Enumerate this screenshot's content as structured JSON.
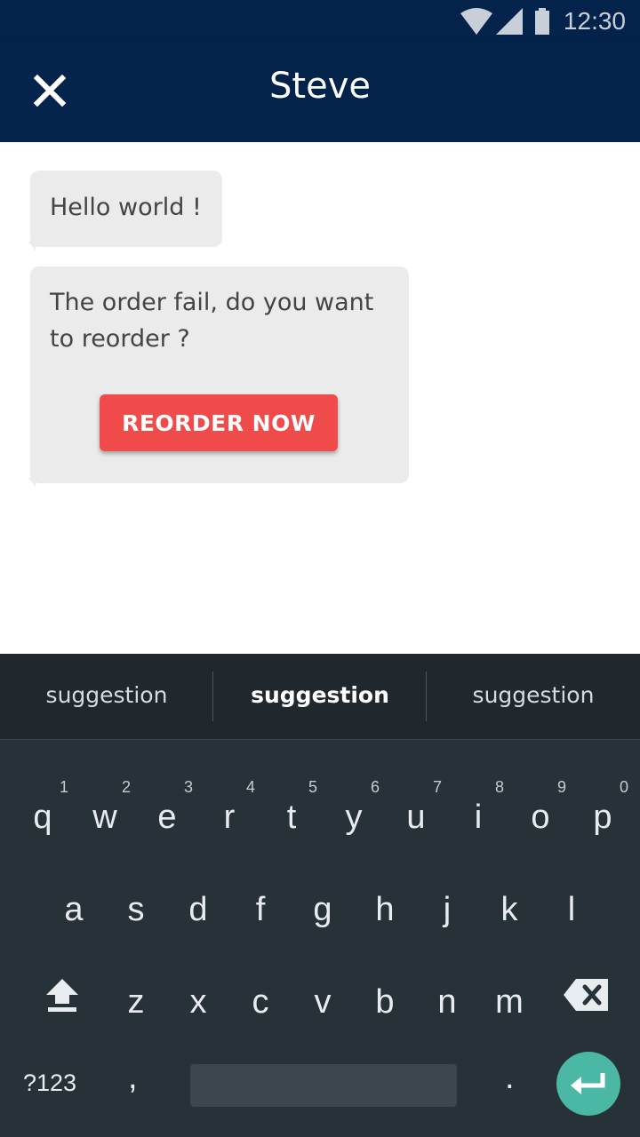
{
  "status_bar": {
    "time": "12:30"
  },
  "app_bar": {
    "title": "Steve"
  },
  "messages": [
    {
      "text": "Hello world !"
    },
    {
      "text": "The order fail, do you want to reorder ?",
      "button_label": "REORDER NOW"
    }
  ],
  "keyboard": {
    "suggestions": [
      "suggestion",
      "suggestion",
      "suggestion"
    ],
    "row1": [
      {
        "key": "q",
        "hint": "1"
      },
      {
        "key": "w",
        "hint": "2"
      },
      {
        "key": "e",
        "hint": "3"
      },
      {
        "key": "r",
        "hint": "4"
      },
      {
        "key": "t",
        "hint": "5"
      },
      {
        "key": "y",
        "hint": "6"
      },
      {
        "key": "u",
        "hint": "7"
      },
      {
        "key": "i",
        "hint": "8"
      },
      {
        "key": "o",
        "hint": "9"
      },
      {
        "key": "p",
        "hint": "0"
      }
    ],
    "row2": [
      "a",
      "s",
      "d",
      "f",
      "g",
      "h",
      "j",
      "k",
      "l"
    ],
    "row3": [
      "z",
      "x",
      "c",
      "v",
      "b",
      "n",
      "m"
    ],
    "symbols_label": "?123",
    "comma": ",",
    "period": "."
  },
  "colors": {
    "app_bar": "#03234b",
    "reorder_button": "#ef4b4b",
    "enter_key": "#4bb7a5",
    "keyboard_bg": "#263238"
  }
}
